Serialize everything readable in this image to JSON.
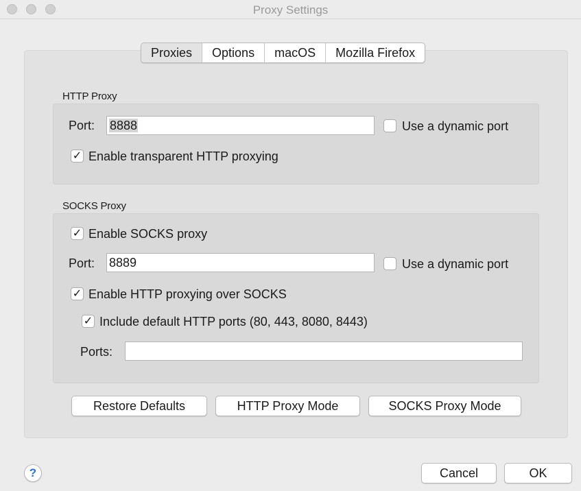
{
  "window": {
    "title": "Proxy Settings"
  },
  "tabs": [
    {
      "label": "Proxies",
      "active": true
    },
    {
      "label": "Options"
    },
    {
      "label": "macOS"
    },
    {
      "label": "Mozilla Firefox"
    }
  ],
  "http_proxy": {
    "title": "HTTP Proxy",
    "port_label": "Port:",
    "port_value": "8888",
    "dynamic_port_label": "Use a dynamic port",
    "dynamic_port_checked": false,
    "transparent_label": "Enable transparent HTTP proxying",
    "transparent_checked": true
  },
  "socks_proxy": {
    "title": "SOCKS Proxy",
    "enable_label": "Enable SOCKS proxy",
    "enable_checked": true,
    "port_label": "Port:",
    "port_value": "8889",
    "dynamic_port_label": "Use a dynamic port",
    "dynamic_port_checked": false,
    "http_over_socks_label": "Enable HTTP proxying over SOCKS",
    "http_over_socks_checked": true,
    "include_default_label": "Include default HTTP ports (80, 443, 8080, 8443)",
    "include_default_checked": true,
    "ports_label": "Ports:",
    "ports_value": ""
  },
  "buttons": {
    "restore_defaults": "Restore Defaults",
    "http_proxy_mode": "HTTP Proxy Mode",
    "socks_proxy_mode": "SOCKS Proxy Mode",
    "cancel": "Cancel",
    "ok": "OK",
    "help": "?"
  },
  "icons": {
    "check": "✓"
  },
  "colors": {
    "accent": "#2b72d8"
  }
}
